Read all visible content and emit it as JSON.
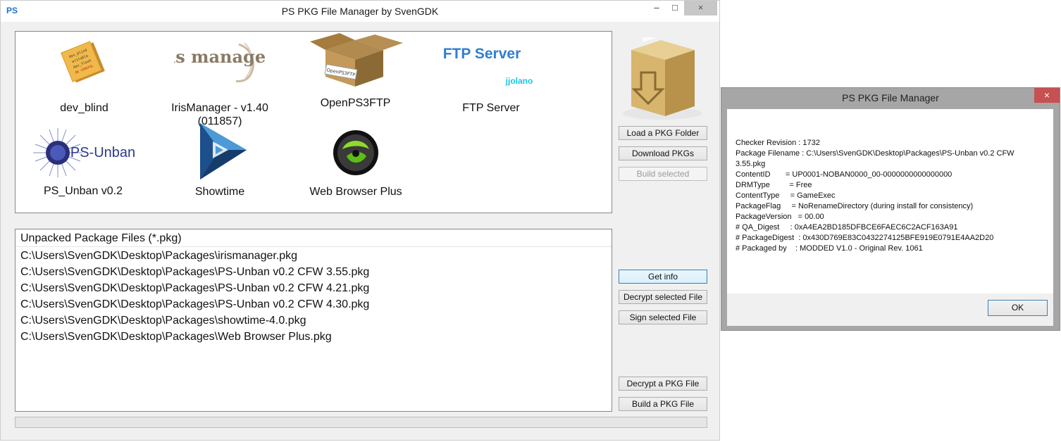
{
  "main_window": {
    "app_icon": "PS",
    "title": "PS PKG File Manager by SvenGDK",
    "controls": {
      "minimize": "–",
      "maximize": "□",
      "close": "×"
    }
  },
  "icon_panel": {
    "tiles": [
      {
        "label": "dev_blind",
        "icon": "sticky-note-icon",
        "icon_text": [
          "dev_blind",
          "writable",
          "dev_flash",
          "BE CAREFUL"
        ]
      },
      {
        "label": "IrisManager - v1.40",
        "label_line2": "(011857)",
        "icon": "iris-manager-logo",
        "icon_text": "Iris manager"
      },
      {
        "label": "OpenPS3FTP",
        "icon": "open-box-icon",
        "icon_text": "OpenPS3FTP"
      },
      {
        "label": "FTP Server",
        "icon": "ftp-server-logo",
        "icon_text": "FTP Server",
        "icon_subtext": "jjolano"
      },
      {
        "label": "PS_Unban v0.2",
        "icon": "ps-unban-logo",
        "icon_text": "PS-Unban"
      },
      {
        "label": "Showtime",
        "icon": "showtime-logo"
      },
      {
        "label": "Web Browser Plus",
        "icon": "web-browser-plus-logo"
      }
    ]
  },
  "buttons": {
    "load_folder": "Load a PKG Folder",
    "download": "Download PKGs",
    "build_selected": "Build selected",
    "get_info": "Get info",
    "decrypt_selected": "Decrypt selected File",
    "sign_selected": "Sign selected File",
    "decrypt_pkg": "Decrypt a PKG File",
    "build_pkg": "Build a PKG File"
  },
  "file_list": {
    "header": "Unpacked Package Files (*.pkg)",
    "rows": [
      "C:\\Users\\SvenGDK\\Desktop\\Packages\\irismanager.pkg",
      "C:\\Users\\SvenGDK\\Desktop\\Packages\\PS-Unban v0.2 CFW 3.55.pkg",
      "C:\\Users\\SvenGDK\\Desktop\\Packages\\PS-Unban v0.2 CFW 4.21.pkg",
      "C:\\Users\\SvenGDK\\Desktop\\Packages\\PS-Unban v0.2 CFW 4.30.pkg",
      "C:\\Users\\SvenGDK\\Desktop\\Packages\\showtime-4.0.pkg",
      "C:\\Users\\SvenGDK\\Desktop\\Packages\\Web Browser Plus.pkg"
    ]
  },
  "dialog": {
    "title": "PS PKG File Manager",
    "close": "×",
    "lines": [
      "Checker Revision : 1732",
      "Package Filename : C:\\Users\\SvenGDK\\Desktop\\Packages\\PS-Unban v0.2 CFW",
      "3.55.pkg",
      "ContentID       = UP0001-NOBAN0000_00-0000000000000000",
      "DRMType         = Free",
      "ContentType     = GameExec",
      "PackageFlag     = NoRenameDirectory (during install for consistency)",
      "PackageVersion   = 00.00",
      "# QA_Digest     : 0xA4EA2BD185DFBCE6FAEC6C2ACF163A91",
      "# PackageDigest  : 0x430D769E83C0432274125BFE919E0791E4AA2D20",
      "# Packaged by    : MODDED V1.0 - Original Rev. 1061"
    ],
    "ok": "OK"
  },
  "colors": {
    "accent": "#3c7fb1",
    "ftp_blue": "#2f7fd0",
    "jjolano_cyan": "#19c4e8"
  }
}
